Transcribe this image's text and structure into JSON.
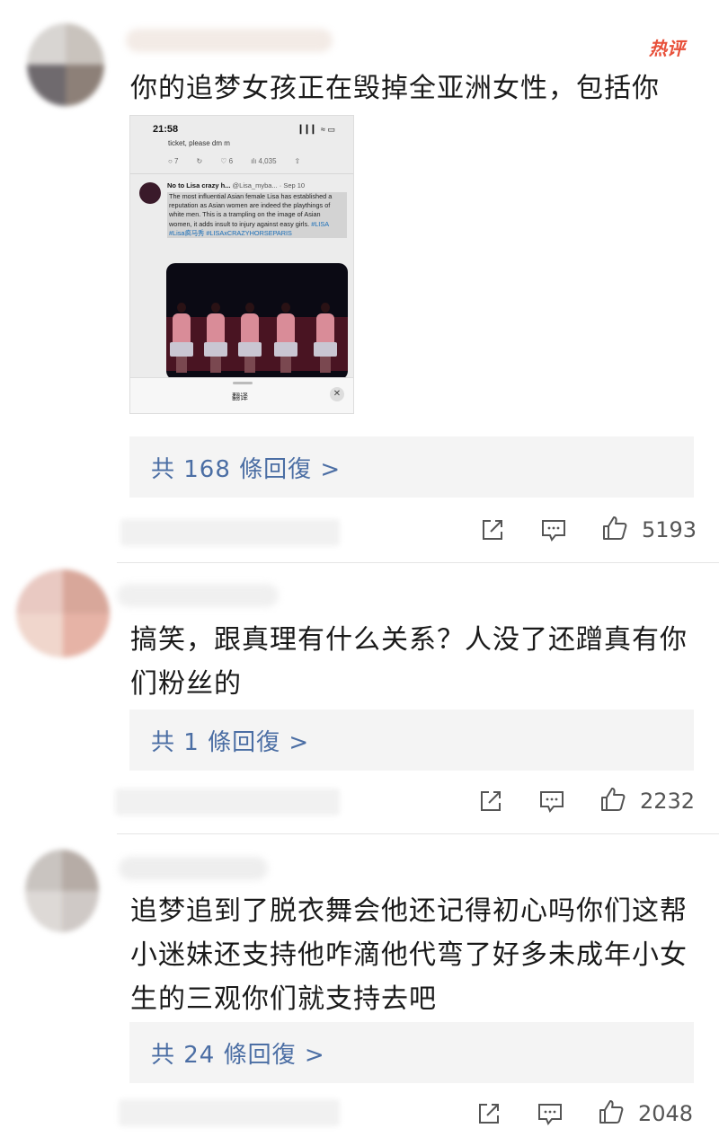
{
  "comments": [
    {
      "hot_badge": "热评",
      "text": "你的追梦女孩正在毁掉全亚洲女性，包括你",
      "replies": "共 168 條回復 >",
      "likes": "5193",
      "avatar_colors": [
        "#d8d5d2",
        "#c9c3bd",
        "#6f6a6e",
        "#8d8078"
      ],
      "embedded_screenshot": {
        "time": "21:58",
        "status_icons": "▎▎▎  ≈  ▭",
        "prev_tweet_text": "ticket, please dm m",
        "stats": [
          "○ 7",
          "↻",
          "♡ 6",
          "ılı 4,035",
          "⇧"
        ],
        "author": "No to Lisa crazy h...",
        "handle_date": "@Lisa_myba... · Sep 10",
        "tweet_text": "The most influential Asian female Lisa has established a reputation as Asian women are indeed the playthings of white men. This is a trampling on the image of Asian women, it adds insult to injury against easy girls.",
        "tweet_tags": "#LISA #Lisa疯马秀 #LISAxCRAZYHORSEPARIS",
        "translate_label": "翻译",
        "close_label": "✕"
      }
    },
    {
      "text_line1": "搞笑，跟真理有什么关系？人没了还蹭真有你",
      "text_line2": "们粉丝的",
      "replies": "共 1 條回復 >",
      "likes": "2232",
      "avatar_colors": [
        "#e9c9c2",
        "#d8a79a",
        "#f0d6cc",
        "#e6b3a6"
      ]
    },
    {
      "text_line1": "追梦追到了脱衣舞会他还记得初心吗你们这帮",
      "text_line2": "小迷妹还支持他咋滴他代弯了好多未成年小女",
      "text_line3": "生的三观你们就支持去吧",
      "replies": "共 24 條回復 >",
      "likes": "2048",
      "avatar_colors": [
        "#c9c4c0",
        "#b6aca6",
        "#ddd9d6",
        "#cfc9c6"
      ]
    }
  ],
  "colors": {
    "reply_link": "#4b6ea4",
    "hot_badge": "#e8503a",
    "reply_bg": "#f4f4f4",
    "icon": "#555555"
  },
  "icons": [
    "share-icon",
    "comment-icon",
    "like-icon"
  ]
}
